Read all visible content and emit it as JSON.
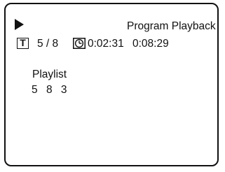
{
  "screen": {
    "mode_title": "Program Playback",
    "title_icon_letter": "T",
    "track_value": "5 / 8",
    "elapsed_time": "0:02:31",
    "total_time": "0:08:29",
    "playlist_label": "Playlist",
    "playlist_items": [
      "5",
      "8",
      "3"
    ],
    "icons": [
      "play-icon",
      "title-icon",
      "clock-icon"
    ]
  }
}
